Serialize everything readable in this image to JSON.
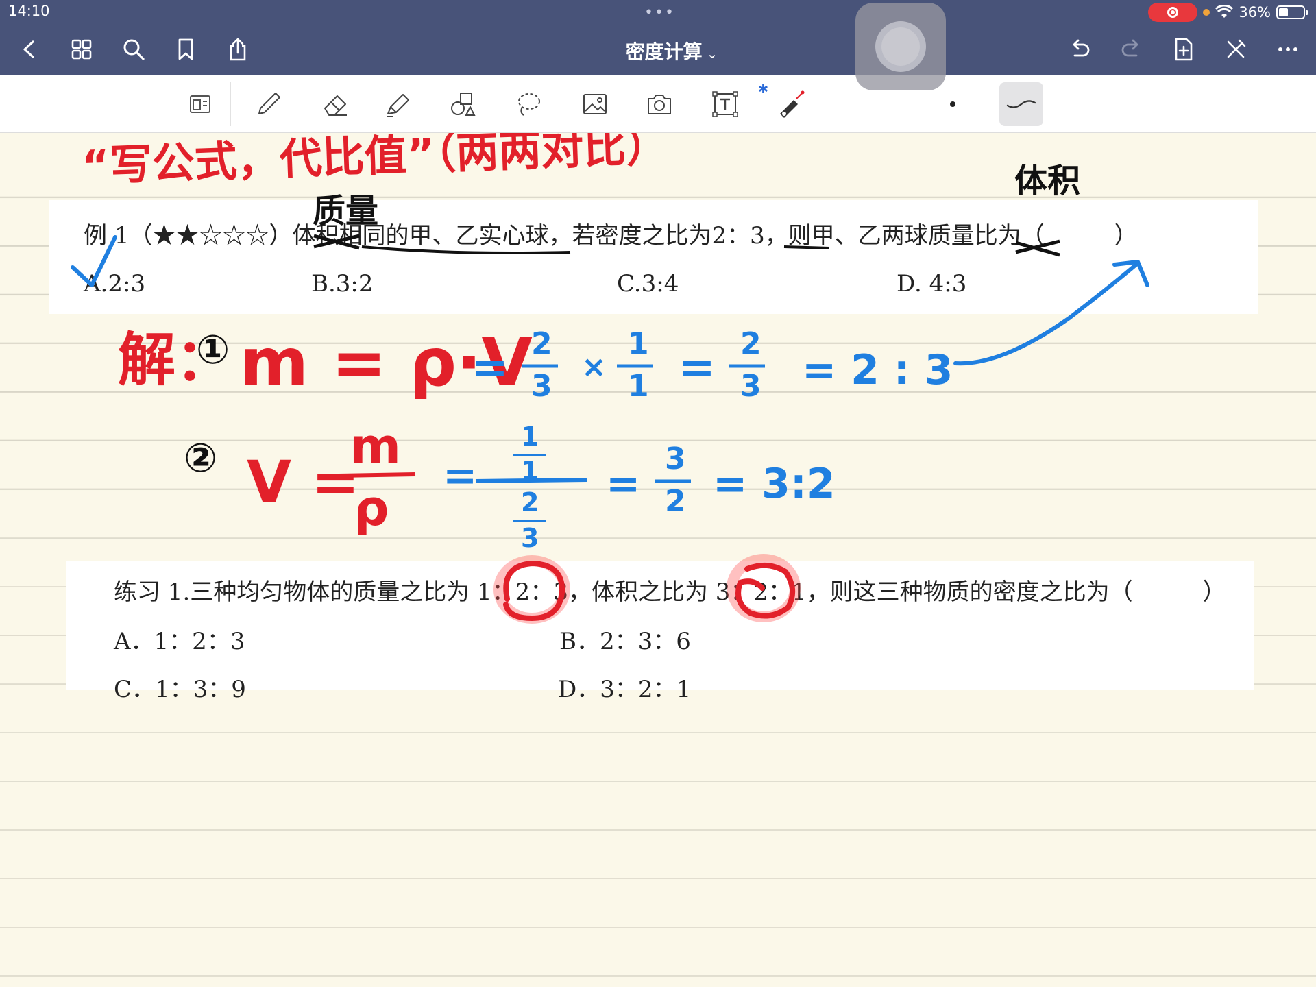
{
  "status": {
    "time": "14:10",
    "battery": "36%"
  },
  "nav": {
    "doc_title": "密度计算",
    "title_chevron": "⌄"
  },
  "toolbar": {
    "tools": [
      "page-view-icon",
      "pen-icon",
      "eraser-icon",
      "highlighter-icon",
      "shapes-icon",
      "lasso-icon",
      "image-icon",
      "camera-icon",
      "text-box-icon",
      "laser-pointer-icon"
    ]
  },
  "example1": {
    "prompt_prefix": "例 1（★★☆☆☆）体积相同的甲、乙实心球，若密度之比为",
    "ratio": "2：3",
    "prompt_suffix": "，则甲、乙两球质量比为（　　　）",
    "options": [
      "A.2:3",
      "B.3:2",
      "C.3:4",
      "D. 4:3"
    ]
  },
  "practice1": {
    "prompt": "练习 1.三种均匀物体的质量之比为 1：2：3，体积之比为 3：2：1，则这三种物质的密度之比为（　　　）",
    "options": [
      "A．1：2：3",
      "B．2：3：6",
      "C．1：3：9",
      "D．3：2：1"
    ]
  },
  "annotations": {
    "heading": "“写公式，代比值”（两两对比）",
    "mass_note": "质量",
    "volume_note": "体积",
    "solution_label": "解：",
    "step1_num": "①",
    "step1_formula": "m = ρ·V",
    "step1_calc_a": "2",
    "step1_calc_b": "3",
    "step1_times": "×",
    "step1_one_a": "1",
    "step1_one_b": "1",
    "step1_res_a": "2",
    "step1_res_b": "3",
    "step1_ratio": "= 2 : 3",
    "step2_num": "②",
    "step2_lhs": "V =",
    "step2_m": "m",
    "step2_rho": "ρ",
    "step2_top": "1",
    "step2_top2": "1",
    "step2_bot_a": "2",
    "step2_bot_b": "3",
    "step2_res_a": "3",
    "step2_res_b": "2",
    "step2_ratio": "= 3:2",
    "equals": "="
  },
  "colors": {
    "bar": "#485379",
    "red_ink": "#e2202a",
    "blue_ink": "#1f7fe0",
    "paper": "#fbf8e9"
  }
}
